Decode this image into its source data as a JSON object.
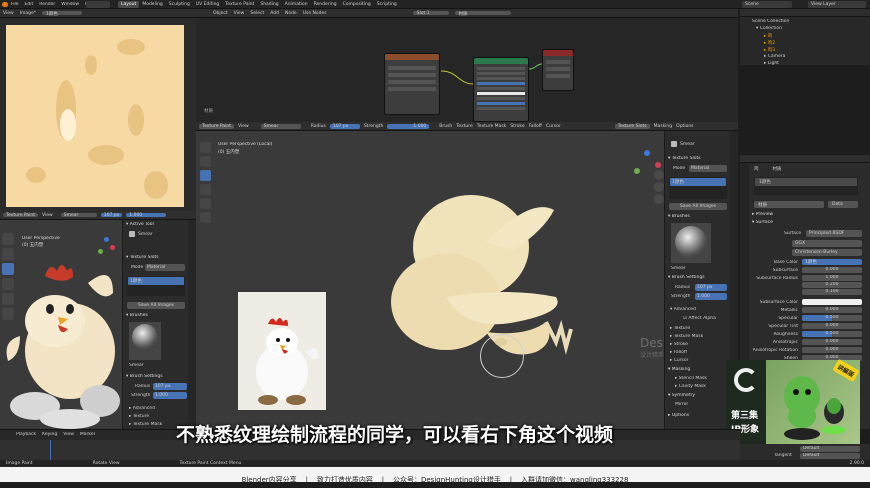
{
  "menubar": {
    "items": [
      "File",
      "Edit",
      "Render",
      "Window",
      "Help"
    ],
    "workspaces": [
      "Layout",
      "Modeling",
      "Sculpting",
      "UV Editing",
      "Texture Paint",
      "Shading",
      "Animation",
      "Rendering",
      "Compositing",
      "Scripting"
    ],
    "active_workspace": "Layout",
    "scene": "Scene",
    "view_layer": "View Layer"
  },
  "image_editor": {
    "view": "View",
    "image": "Image*",
    "image_name": "1颜色"
  },
  "node_editor": {
    "object": "Object",
    "view": "View",
    "select": "Select",
    "add": "Add",
    "node": "Node",
    "use_nodes": "Use Nodes",
    "slot": "Slot 1",
    "material": "材质",
    "material_label": "材质"
  },
  "viewport_small": {
    "mode": "Texture Paint",
    "view": "View",
    "brush": "Smear",
    "radius": "107 px",
    "strength": "1.000",
    "title": "User Perspective",
    "subtitle": "(0) 五内塑"
  },
  "viewport_main": {
    "mode": "Texture Paint",
    "view": "View",
    "brush": "Smear",
    "radius_label": "Radius",
    "radius": "107 px",
    "strength_label": "Strength",
    "strength": "1.000",
    "menus": [
      "Brush",
      "Texture",
      "Texture Mask",
      "Stroke",
      "Falloff",
      "Cursor"
    ],
    "title": "User Perspective (Local)",
    "subtitle": "(0) 五内塑",
    "texture_slots_tab": "Texture Slots",
    "masking": "Masking",
    "options": "Options"
  },
  "tool_panel": {
    "brush_name": "Smear",
    "texture_slots": "Texture Slots",
    "mode_label": "Mode",
    "mode_value": "Material",
    "slot_item": "1颜色",
    "save_all": "Save All Images",
    "brushes": "Brushes",
    "brush_thumb_label": "Smear",
    "brush_settings": "Brush Settings",
    "radius_label": "Radius",
    "radius": "107 px",
    "strength_label": "Strength",
    "strength": "1.000",
    "advanced": "Advanced",
    "affect_alpha": "Affect Alpha",
    "sections": [
      "Texture",
      "Texture Mask",
      "Stroke",
      "Falloff",
      "Cursor"
    ],
    "masking": "Masking",
    "stencil_mask": "Stencil Mask",
    "cavity_mask": "Cavity Mask",
    "symmetry": "Symmetry",
    "mirror": "Mirror",
    "options": "Options"
  },
  "small_tool_panel": {
    "active_tool": "Active Tool",
    "brush": "Smear",
    "texture_slots": "Texture Slots",
    "mode_label": "Mode",
    "mode_value": "Material",
    "slot_item": "1颜色",
    "save_all": "Save All Images",
    "brushes": "Brushes",
    "brush_thumb_label": "Smear",
    "brush_settings": "Brush Settings",
    "radius_label": "Radius",
    "radius": "107 px",
    "strength_label": "Strength",
    "strength": "1.000",
    "advanced": "Advanced",
    "texture": "Texture",
    "texture_mask": "Texture Mask"
  },
  "outliner": {
    "title": "Scene Collection",
    "items": [
      "Collection",
      "鸡",
      "鸡2",
      "鸡3",
      "Camera",
      "Light"
    ]
  },
  "properties": {
    "object": "鸡",
    "material": "材质",
    "slot": "1颜色",
    "data": "Data",
    "preview": "Preview",
    "surface": "Surface",
    "surface_label": "Surface",
    "surface_value": "Principled BSDF",
    "distribution": "GGX",
    "subsurface_method": "Christensen-Burley",
    "rows": [
      {
        "label": "Base Color",
        "value": "1颜色"
      },
      {
        "label": "Subsurface",
        "value": "0.000"
      },
      {
        "label": "Subsurface Radius",
        "value": "1.000"
      },
      {
        "label": "",
        "value": "0.200"
      },
      {
        "label": "",
        "value": "0.100"
      },
      {
        "label": "Subsurface Color",
        "value": ""
      },
      {
        "label": "Metallic",
        "value": "0.000"
      },
      {
        "label": "Specular",
        "value": "0.500"
      },
      {
        "label": "Specular Tint",
        "value": "0.000"
      },
      {
        "label": "Roughness",
        "value": "0.500"
      },
      {
        "label": "Anisotropic",
        "value": "0.000"
      },
      {
        "label": "Anisotropic Rotation",
        "value": "0.000"
      },
      {
        "label": "Sheen",
        "value": "0.000"
      }
    ],
    "clearcoat_normal_label": "Clearcoat Normal",
    "clearcoat_normal_value": "Default",
    "tangent_label": "Tangent",
    "tangent_value": "Default"
  },
  "timeline": {
    "playback": "Playback",
    "keying": "Keying",
    "view": "View",
    "marker": "Marker",
    "frame": "150"
  },
  "statusbar": {
    "left1": "Image Paint",
    "left2": "Rotate View",
    "left3": "Texture Paint Context Menu",
    "version": "2.90.0"
  },
  "subtitle": "不熟悉纹理绘制流程的同学，可以看右下角这个视频",
  "watermark": {
    "line1": "DesignHunting",
    "line2": "设计猎手 · 公众号 · 基础部分"
  },
  "promo": {
    "episode": "第三集",
    "topic": "IP形象",
    "badge": "讲解版"
  },
  "footer": "Blender内容分享    |    致力打造优质内容    |    公众号：DesignHunting设计猎手    |    入群请加微信：wangling333228"
}
